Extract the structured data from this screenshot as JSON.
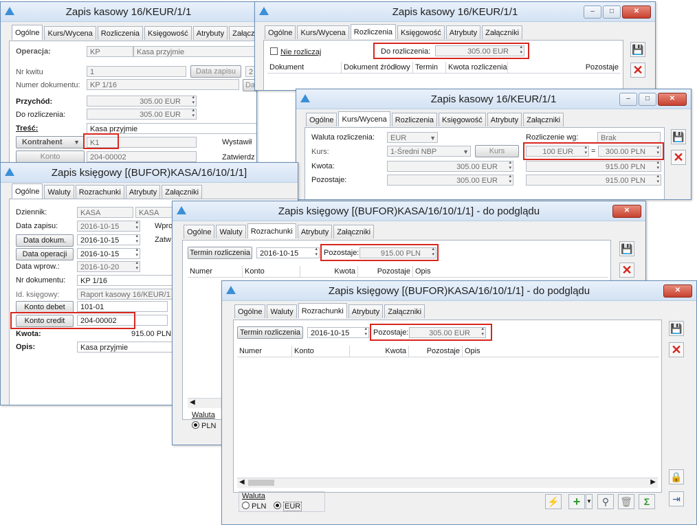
{
  "w1": {
    "title": "Zapis kasowy 16/KEUR/1/1",
    "tabs": [
      "Ogólne",
      "Kurs/Wycena",
      "Rozliczenia",
      "Księgowość",
      "Atrybuty",
      "Załączniki"
    ],
    "operacja_label": "Operacja:",
    "operacja_code": "KP",
    "operacja_name": "Kasa przyjmie",
    "nr_kwitu_label": "Nr kwitu",
    "nr_kwitu": "1",
    "data_zapisu_btn": "Data zapisu",
    "data_zapisu_cut": "2",
    "numer_dok_label": "Numer dokumentu:",
    "numer_dok": "KP 1/16",
    "da_cut": "Da",
    "przychod_label": "Przychód:",
    "przychod": "305.00 EUR",
    "do_rozliczenia_label": "Do rozliczenia:",
    "do_rozliczenia": "305.00 EUR",
    "tresc_label": "Treść:",
    "tresc": "Kasa przyjmie",
    "kontrahent_label": "Kontrahent",
    "kontrahent": "K1",
    "wystawil_cut": "Wystawił",
    "konto_label": "Konto",
    "konto": "204-00002",
    "zatwierdz_cut": "Zatwierdz"
  },
  "w2": {
    "title": "Zapis kasowy 16/KEUR/1/1",
    "tabs": [
      "Ogólne",
      "Kurs/Wycena",
      "Rozliczenia",
      "Księgowość",
      "Atrybuty",
      "Załączniki"
    ],
    "nie_rozliczaj": "Nie rozliczaj",
    "do_rozliczenia_label": "Do rozliczenia:",
    "do_rozliczenia": "305.00 EUR",
    "cols": [
      "Dokument",
      "Dokument źródłowy",
      "Termin",
      "Kwota rozliczenia",
      "Pozostaje"
    ]
  },
  "w3": {
    "title": "Zapis kasowy 16/KEUR/1/1",
    "tabs": [
      "Ogólne",
      "Kurs/Wycena",
      "Rozliczenia",
      "Księgowość",
      "Atrybuty",
      "Załączniki"
    ],
    "waluta_label": "Waluta rozliczenia:",
    "waluta": "EUR",
    "rozliczenie_label": "Rozliczenie wg:",
    "rozliczenie": "Brak",
    "kurs_label": "Kurs:",
    "kurs_type": "1-Średni NBP",
    "kurs_btn": "Kurs",
    "kurs_eur": "100 EUR",
    "eq": "=",
    "kurs_pln": "300.00 PLN",
    "kwota_label": "Kwota:",
    "kwota_eur": "305.00 EUR",
    "kwota_pln": "915.00 PLN",
    "pozostaje_label": "Pozostaje:",
    "pozostaje_eur": "305.00 EUR",
    "pozostaje_pln": "915.00 PLN"
  },
  "w4": {
    "title": "Zapis księgowy [(BUFOR)KASA/16/10/1/1]",
    "tabs": [
      "Ogólne",
      "Waluty",
      "Rozrachunki",
      "Atrybuty",
      "Załączniki"
    ],
    "dziennik_label": "Dziennik:",
    "dziennik": "KASA",
    "dziennik2": "KASA",
    "data_zapisu_label": "Data zapisu:",
    "data_zapisu": "2016-10-15",
    "wpro_cut": "Wpro",
    "data_dokum_btn": "Data dokum.",
    "data_dokum": "2016-10-15",
    "zatw_cut": "Zatw",
    "data_operacji_btn": "Data operacji",
    "data_operacji": "2016-10-15",
    "data_wprow_label": "Data wprow.:",
    "data_wprow": "2016-10-20",
    "nr_dok_label": "Nr dokumentu:",
    "nr_dok": "KP 1/16",
    "id_ks_label": "Id. księgowy:",
    "id_ks": "Raport kasowy 16/KEUR/1",
    "konto_debet_btn": "Konto debet",
    "konto_debet": "101-01",
    "konto_credit_btn": "Konto credit",
    "konto_credit": "204-00002",
    "kwota_label": "Kwota:",
    "kwota": "915.00 PLN",
    "opis_label": "Opis:",
    "opis": "Kasa przyjmie"
  },
  "w5": {
    "title": "Zapis księgowy [(BUFOR)KASA/16/10/1/1] - do podglądu",
    "tabs": [
      "Ogólne",
      "Waluty",
      "Rozrachunki",
      "Atrybuty",
      "Załączniki"
    ],
    "termin_btn": "Termin rozliczenia",
    "termin": "2016-10-15",
    "pozostaje_label": "Pozostaje:",
    "pozostaje": "915.00 PLN",
    "cols": [
      "Numer",
      "Konto",
      "Kwota",
      "Pozostaje",
      "Opis"
    ],
    "waluta_label": "Waluta",
    "radio_pln": "PLN"
  },
  "w6": {
    "title": "Zapis księgowy [(BUFOR)KASA/16/10/1/1] - do podglądu",
    "tabs": [
      "Ogólne",
      "Waluty",
      "Rozrachunki",
      "Atrybuty",
      "Załączniki"
    ],
    "termin_btn": "Termin rozliczenia",
    "termin": "2016-10-15",
    "pozostaje_label": "Pozostaje:",
    "pozostaje": "305.00 EUR",
    "cols": [
      "Numer",
      "Konto",
      "Kwota",
      "Pozostaje",
      "Opis"
    ],
    "waluta_label": "Waluta",
    "radio_pln": "PLN",
    "radio_eur": "EUR"
  },
  "icons": {
    "save": "save-icon",
    "cancel": "cancel-icon",
    "lightning": "lightning-icon",
    "add": "add-icon",
    "search": "search-icon",
    "trash": "trash-icon",
    "sum": "sum-icon",
    "lock": "lock-icon",
    "pin": "pin-icon"
  },
  "colors": {
    "highlight": "#d7261e",
    "accent": "#3b8fd6"
  }
}
